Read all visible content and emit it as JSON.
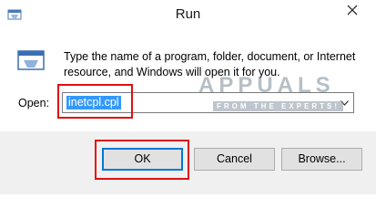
{
  "window": {
    "title": "Run"
  },
  "icons": {
    "app": "run-app-icon",
    "close": "close-icon",
    "dropdown": "chevron-down-icon"
  },
  "description": "Type the name of a program, folder, document, or Internet resource, and Windows will open it for you.",
  "open": {
    "label": "Open:",
    "value": "inetcpl.cpl"
  },
  "buttons": {
    "ok": "OK",
    "cancel": "Cancel",
    "browse": "Browse..."
  },
  "watermark": {
    "main": "APPUALS",
    "sub": "FROM THE EXPERTS!"
  },
  "colors": {
    "highlight": "#e01010",
    "selection": "#3399ff",
    "default_button_border": "#0078d7"
  }
}
